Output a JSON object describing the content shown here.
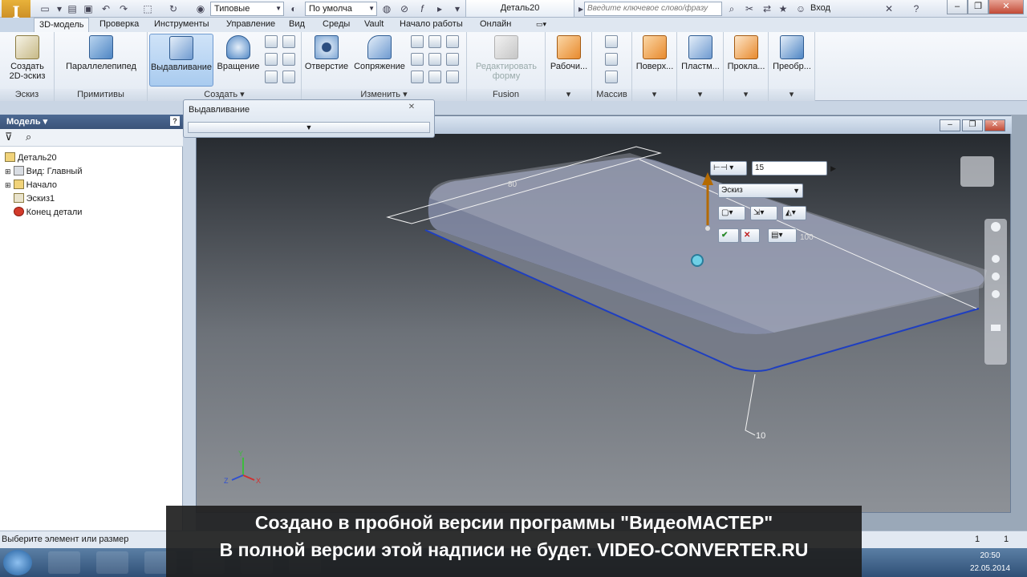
{
  "titlebar": {
    "style_combo": "Типовые",
    "material_combo": "По умолча",
    "document_title": "Деталь20",
    "search_placeholder": "Введите ключевое слово/фразу",
    "login": "Вход"
  },
  "tabs": [
    "3D-модель",
    "Проверка",
    "Инструменты",
    "Управление",
    "Вид",
    "Среды",
    "Vault",
    "Начало работы",
    "Онлайн"
  ],
  "ribbon": {
    "panels": {
      "sketch": "Эскиз",
      "primitives": "Примитивы",
      "create": "Создать",
      "modify": "Изменить",
      "fusion": "Fusion",
      "array": "Массив"
    },
    "buttons": {
      "create_sketch": "Создать 2D-эскиз",
      "box": "Параллелепипед",
      "extrude": "Выдавливание",
      "revolve": "Вращение",
      "hole": "Отверстие",
      "fillet": "Сопряжение",
      "edit_form": "Редактировать форму",
      "work": "Рабочи...",
      "surface": "Поверх...",
      "plastic": "Пластм...",
      "gasket": "Прокла...",
      "convert": "Преобр..."
    }
  },
  "browser": {
    "title": "Модель",
    "items": [
      {
        "label": "Деталь20",
        "level": 0
      },
      {
        "label": "Вид: Главный",
        "level": 1
      },
      {
        "label": "Начало",
        "level": 1
      },
      {
        "label": "Эскиз1",
        "level": 1
      },
      {
        "label": "Конец детали",
        "level": 1
      }
    ]
  },
  "extrude_dialog": {
    "title": "Выдавливание"
  },
  "mini_toolbar": {
    "distance_value": "15",
    "profile_label": "Эскиз"
  },
  "viewport": {
    "dimension_80": "80",
    "dimension_100": "100",
    "dimension_10": "10",
    "axes": {
      "z": "Z",
      "x": "X",
      "y": "Y"
    }
  },
  "watermark": {
    "line1": "Создано в пробной версии программы \"ВидеоМАСТЕР\"",
    "line2": "В полной версии этой надписи не будет. VIDEO-CONVERTER.RU"
  },
  "statusbar": {
    "text": "Выберите элемент или размер",
    "count1": "1",
    "count2": "1"
  },
  "taskbar": {
    "time": "20:50",
    "date": "22.05.2014"
  },
  "colors": {
    "ribbon_bg": "#e3eaf3",
    "browser_header": "#3b5379",
    "viewport_top": "#202429",
    "selected_edge": "#1f3fc0",
    "extrude_arrow": "#b46a00"
  }
}
